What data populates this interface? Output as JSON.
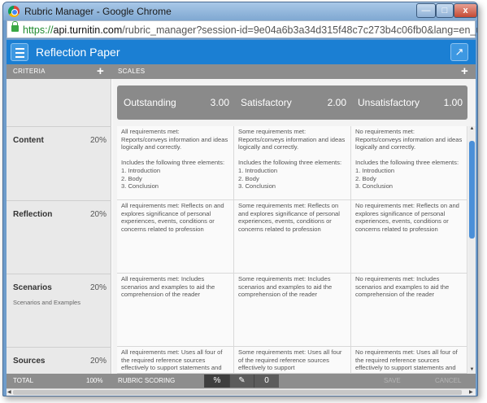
{
  "window": {
    "title": "Rubric Manager - Google Chrome",
    "close_label": "x"
  },
  "address": {
    "scheme": "https://",
    "host": "api.turnitin.com",
    "path": "/rubric_manager?session-id=9e04a6b3a34d315f48c7c273b4c06fb0&lang=en_us"
  },
  "app": {
    "title": "Reflection Paper",
    "accent_color": "#1b7fd3",
    "criteria_header": "CRITERIA",
    "scales_header": "SCALES",
    "add_label": "+"
  },
  "scales": [
    {
      "name": "Outstanding",
      "value": "3.00"
    },
    {
      "name": "Satisfactory",
      "value": "2.00"
    },
    {
      "name": "Unsatisfactory",
      "value": "1.00"
    }
  ],
  "criteria": [
    {
      "name": "Content",
      "percent": "20%",
      "subtitle": "",
      "cells": [
        "All requirements met:\nReports/conveys information and ideas logically and correctly.\n\nIncludes the following three elements:\n1. Introduction\n2. Body\n3. Conclusion",
        "Some requirements met:\nReports/conveys information and ideas logically and correctly.\n\nIncludes the following three elements:\n1. Introduction\n2. Body\n3. Conclusion",
        "No requirements met:\nReports/conveys information and ideas logically and correctly.\n\nIncludes the following three elements:\n1. Introduction\n2. Body\n3. Conclusion"
      ]
    },
    {
      "name": "Reflection",
      "percent": "20%",
      "subtitle": "",
      "cells": [
        "All requirements met: Reflects on and explores significance of personal experiences, events, conditions or concerns related to profession",
        "Some requirements met: Reflects on and explores significance of personal experiences, events, conditions or concerns related to profession",
        "No requirements met: Reflects on and explores significance of personal experiences, events, conditions or concerns related to profession"
      ]
    },
    {
      "name": "Scenarios",
      "percent": "20%",
      "subtitle": "Scenarios and Examples",
      "cells": [
        "All requirements met: Includes scenarios and examples to aid the comprehension of the reader",
        "Some requirements met: Includes scenarios and examples to aid the comprehension of the reader",
        "No requirements met: Includes scenarios and examples to aid the comprehension of the reader"
      ]
    },
    {
      "name": "Sources",
      "percent": "20%",
      "subtitle": "",
      "cells": [
        "All requirements met: Uses all four of the required reference sources effectively to support statements and",
        "Some requirements met: Uses all four of the required reference sources effectively to support",
        "No requirements met: Uses all four of the required reference sources effectively to support statements and"
      ]
    }
  ],
  "footer": {
    "total_label": "TOTAL",
    "total_value": "100%",
    "scoring_label": "RUBRIC SCORING",
    "percent_mode": "%",
    "zero_mode": "0",
    "save_label": "SAVE",
    "cancel_label": "CANCEL"
  }
}
